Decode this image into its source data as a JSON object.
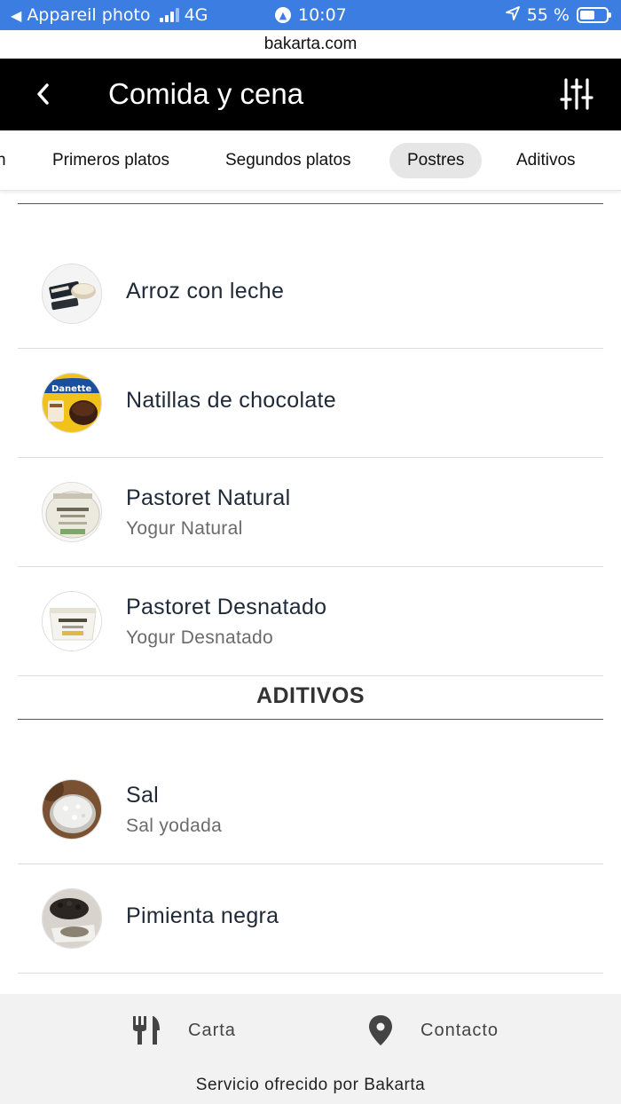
{
  "status_bar": {
    "back_app": "Appareil photo",
    "network": "4G",
    "time": "10:07",
    "battery": "55 %"
  },
  "url": "bakarta.com",
  "header": {
    "title": "Comida y cena",
    "back_icon": "chevron-left-icon",
    "filter_icon": "sliders-icon"
  },
  "tabs": [
    {
      "label": "n"
    },
    {
      "label": "Primeros platos"
    },
    {
      "label": "Segundos platos"
    },
    {
      "label": "Postres",
      "active": true
    },
    {
      "label": "Aditivos"
    }
  ],
  "postres": [
    {
      "name": "Arroz con leche",
      "sub": ""
    },
    {
      "name": "Natillas de chocolate",
      "sub": ""
    },
    {
      "name": "Pastoret Natural",
      "sub": "Yogur Natural"
    },
    {
      "name": "Pastoret Desnatado",
      "sub": "Yogur Desnatado"
    }
  ],
  "aditivos_section": "ADITIVOS",
  "aditivos": [
    {
      "name": "Sal",
      "sub": "Sal yodada"
    },
    {
      "name": "Pimienta negra",
      "sub": ""
    }
  ],
  "footer": {
    "carta": "Carta",
    "contacto": "Contacto",
    "credit": "Servicio ofrecido por Bakarta"
  },
  "colors": {
    "status_bar": "#3b7de0",
    "header_bg": "#000000",
    "active_tab_bg": "#e6e6e6",
    "footer_bg": "#f2f2f2"
  }
}
